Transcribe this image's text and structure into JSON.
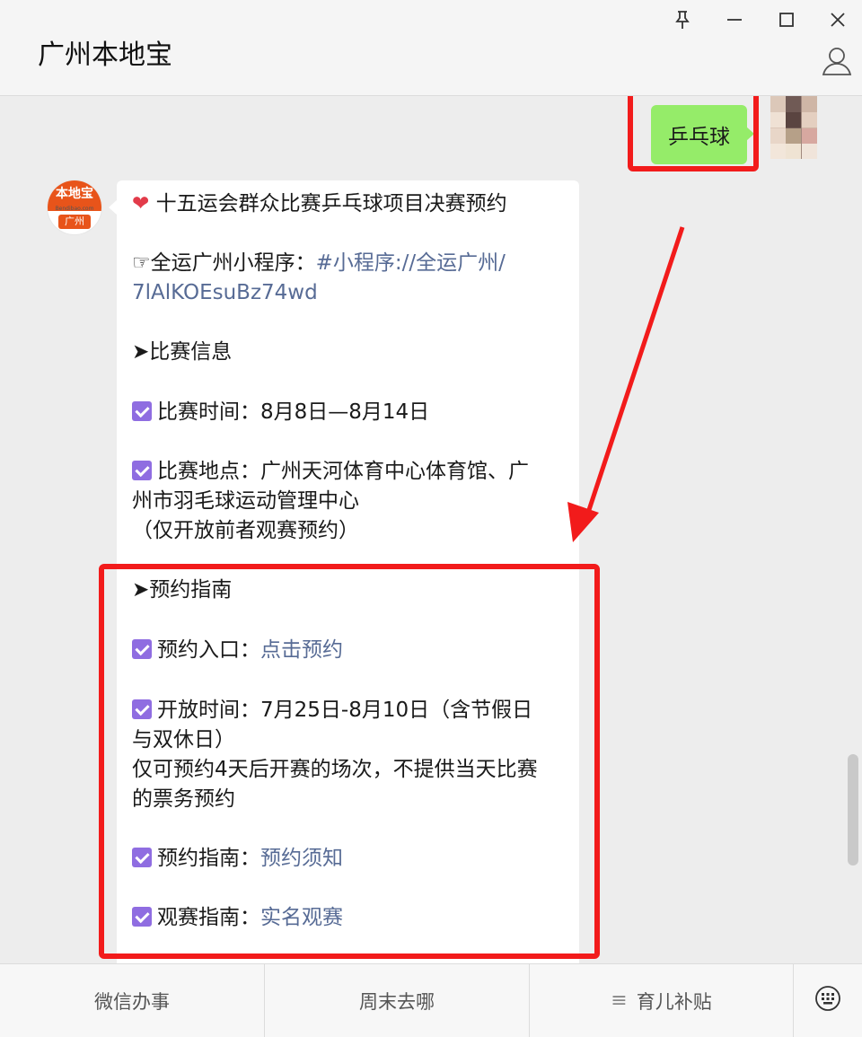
{
  "header": {
    "title": "广州本地宝",
    "pin_icon": "pin-icon",
    "minimize_icon": "minimize-icon",
    "maximize_icon": "maximize-icon",
    "close_icon": "close-icon",
    "user_icon": "user-icon"
  },
  "self_message": {
    "text": "乒乓球"
  },
  "bot_avatar": {
    "top": "本地宝",
    "mid": "Bendibao.com",
    "bottom": "广州"
  },
  "bot_message": {
    "title": "十五运会群众比赛乒乓球项目决赛预约",
    "program_label": "☞全运广州小程序：",
    "program_link_1": "#小程序://全运广州/",
    "program_link_2": "7lAlKOEsuBz74wd",
    "section_info": "➤比赛信息",
    "time_text": "比赛时间：8月8日—8月14日",
    "venue_line1": "比赛地点：广州天河体育中心体育馆、广",
    "venue_line2": "州市羽毛球运动管理中心",
    "venue_line3": "（仅开放前者观赛预约）",
    "section_guide": "➤预约指南",
    "entry_label": "预约入口：",
    "entry_link": "点击预约",
    "open_line1": "开放时间：7月25日-8月10日（含节假日",
    "open_line2": "与双休日）",
    "open_line3": "仅可预约4天后开赛的场次，不提供当天比赛",
    "open_line4": "的票务预约",
    "guide_label": "预约指南：",
    "guide_link": "预约须知",
    "watch_label": "观赛指南：",
    "watch_link": "实名观赛"
  },
  "menu": {
    "item1": "微信办事",
    "item2": "周末去哪",
    "item3": "育儿补贴",
    "keyboard_icon": "keyboard-icon"
  },
  "colors": {
    "highlight": "#f21b1b",
    "link": "#576b95",
    "self_bubble": "#95ec69",
    "checkbox": "#8f6de1"
  }
}
